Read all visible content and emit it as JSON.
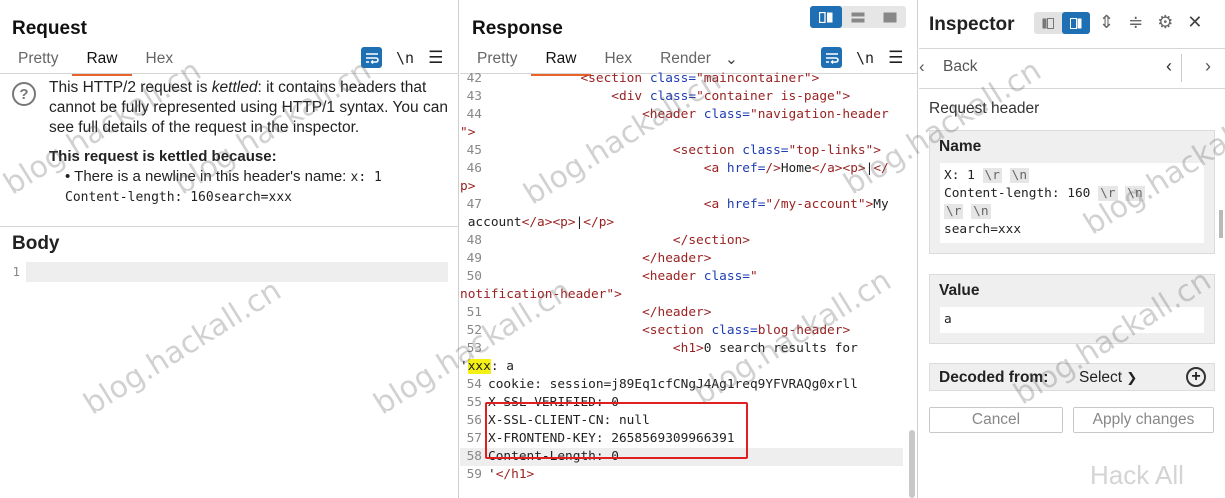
{
  "request": {
    "title": "Request",
    "tabs": [
      "Pretty",
      "Raw",
      "Hex"
    ],
    "active_tab": "Raw",
    "newline_toggle": "\\n",
    "message_pre": "This HTTP/2 request is ",
    "message_em": "kettled",
    "message_post": ": it contains headers that cannot be fully represented using HTTP/1 syntax. You can see full details of the request in the inspector.",
    "reason_heading": "This request is kettled because:",
    "reason_text": "There is a newline in this header's name:",
    "reason_code_1": "x: 1",
    "reason_code_2": "Content-length: 160search=xxx",
    "body_title": "Body",
    "body_line_number": "1"
  },
  "response": {
    "title": "Response",
    "tabs": [
      "Pretty",
      "Raw",
      "Hex",
      "Render"
    ],
    "active_tab": "Raw",
    "newline_toggle": "\\n",
    "top_partial": "<a ... ... -l .ia",
    "lines": [
      {
        "n": "42",
        "html": "            <span class=\"tg\">&lt;section</span> <span class=\"at\">class=</span><span class=\"st\">\"maincontainer\"</span><span class=\"tg\">&gt;</span>"
      },
      {
        "n": "43",
        "html": "                <span class=\"tg\">&lt;div</span> <span class=\"at\">class=</span><span class=\"st\">\"container is-page\"</span><span class=\"tg\">&gt;</span>"
      },
      {
        "n": "44",
        "html": "                    <span class=\"tg\">&lt;header</span> <span class=\"at\">class=</span><span class=\"st\">\"navigation-header</span>"
      },
      {
        "n": "",
        "html": "<span class=\"st\">\"</span><span class=\"tg\">&gt;</span>"
      },
      {
        "n": "45",
        "html": "                        <span class=\"tg\">&lt;section</span> <span class=\"at\">class=</span><span class=\"st\">\"top-links\"</span><span class=\"tg\">&gt;</span>"
      },
      {
        "n": "46",
        "html": "                            <span class=\"tg\">&lt;a</span> <span class=\"at\">href=</span><span class=\"st\">/</span><span class=\"tg\">&gt;</span>Home<span class=\"tg\">&lt;/a&gt;&lt;p&gt;</span>|<span class=\"tg\">&lt;/</span>"
      },
      {
        "n": "",
        "html": "<span class=\"tg\">p&gt;</span>"
      },
      {
        "n": "47",
        "html": "                            <span class=\"tg\">&lt;a</span> <span class=\"at\">href=</span><span class=\"st\">\"/my-account\"</span><span class=\"tg\">&gt;</span>My"
      },
      {
        "n": "",
        "html": " account<span class=\"tg\">&lt;/a&gt;&lt;p&gt;</span>|<span class=\"tg\">&lt;/p&gt;</span>"
      },
      {
        "n": "48",
        "html": "                        <span class=\"tg\">&lt;/section&gt;</span>"
      },
      {
        "n": "49",
        "html": "                    <span class=\"tg\">&lt;/header&gt;</span>"
      },
      {
        "n": "50",
        "html": "                    <span class=\"tg\">&lt;header</span> <span class=\"at\">class=</span><span class=\"st\">\"</span>"
      },
      {
        "n": "",
        "html": "<span class=\"st\">notification-header\"</span><span class=\"tg\">&gt;</span>"
      },
      {
        "n": "51",
        "html": "                    <span class=\"tg\">&lt;/header&gt;</span>"
      },
      {
        "n": "52",
        "html": "                    <span class=\"tg\">&lt;section</span> <span class=\"at\">class=</span><span class=\"st\">blog-header</span><span class=\"tg\">&gt;</span>"
      },
      {
        "n": "53",
        "html": "                        <span class=\"tg\">&lt;h1&gt;</span>0 search results for"
      },
      {
        "n": "",
        "html": "'<span class=\"yh\">xxx</span>: a"
      },
      {
        "n": "54",
        "html": "cookie: session=j89Eq1cfCNgJ4Ag1req9YFVRAQg0xrll"
      },
      {
        "n": "55",
        "html": "X-SSL-VERIFIED: 0"
      },
      {
        "n": "56",
        "html": "X-SSL-CLIENT-CN: null"
      },
      {
        "n": "57",
        "html": "X-FRONTEND-KEY: 2658569309966391"
      },
      {
        "n": "58",
        "html": "Content-Length: 0"
      },
      {
        "n": "59",
        "html": "'<span class=\"tg\">&lt;/h1&gt;</span>"
      }
    ]
  },
  "inspector": {
    "title": "Inspector",
    "back_label": "Back",
    "subtitle": "Request header",
    "name_label": "Name",
    "name_value_html": "X: 1 <span class=\"esc\">\\r</span> <span class=\"esc\">\\n</span>\nContent-length: 160 <span class=\"esc\">\\r</span> <span class=\"esc\">\\n</span>\n<span class=\"esc\">\\r</span> <span class=\"esc\">\\n</span>\nsearch=xxx",
    "value_label": "Value",
    "value_value": "a",
    "decoded_label": "Decoded from:",
    "decoded_select": "Select",
    "cancel_label": "Cancel",
    "apply_label": "Apply changes"
  },
  "watermarks": {
    "text": "blog.hackall.cn",
    "corner": "Hack All"
  },
  "colors": {
    "accent_tab": "#e8622b",
    "toggle_blue": "#1f6fb5",
    "highlight_box": "#e02020",
    "search_highlight": "#f4ef14"
  }
}
